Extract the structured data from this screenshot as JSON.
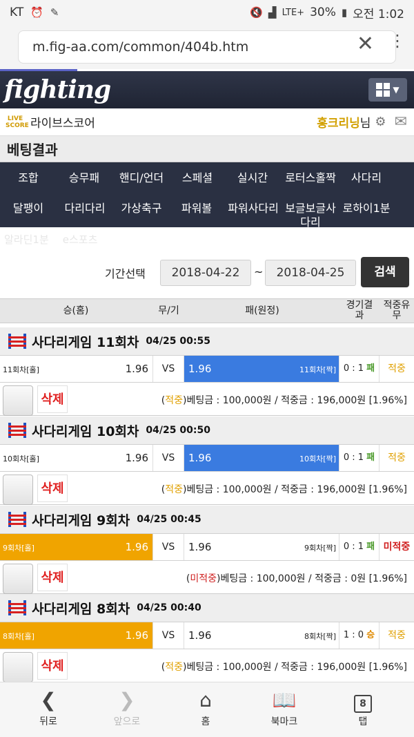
{
  "status_bar": {
    "carrier": "KT",
    "network": "LTE+",
    "battery": "30%",
    "time": "오전 1:02"
  },
  "browser": {
    "url": "m.fig-aa.com/common/404b.htm"
  },
  "site": {
    "logo": "fighting",
    "live_badge": "LIVE SCORE",
    "live_label": "라이브스코어",
    "user_name": "홍크리닝",
    "user_suffix": "님"
  },
  "page_title": "베팅결과",
  "categories": [
    "조합",
    "승무패",
    "핸디/언더",
    "스페셜",
    "실시간",
    "로터스홀짝",
    "사다리",
    "달팽이",
    "다리다리",
    "가상축구",
    "파워볼",
    "파워사다리",
    "보글보글사다리",
    "로하이1분"
  ],
  "categories_extra": [
    "알라딘1분",
    "e스포츠"
  ],
  "filter": {
    "label": "기간선택",
    "from": "2018-04-22",
    "tilde": "~",
    "to": "2018-04-25",
    "search": "검색"
  },
  "table_header": {
    "home": "승(홈)",
    "draw": "무/기",
    "away": "패(원정)",
    "result": "경기결과",
    "hit": "적중유무"
  },
  "games": [
    {
      "title": "사다리게임 11회차",
      "time": "04/25 00:55",
      "home_label": "11회차[홀]",
      "home_odd": "1.96",
      "vs": "VS",
      "away_odd": "1.96",
      "away_label": "11회차[짝]",
      "score": "0 : 1",
      "result": "패",
      "hit": "적중",
      "bet_tag": "적중",
      "bet_text": "베팅금 : 100,000원 / 적중금 : 196,000원 [1.96%]",
      "delete": "삭제"
    },
    {
      "title": "사다리게임 10회차",
      "time": "04/25 00:50",
      "home_label": "10회차[홀]",
      "home_odd": "1.96",
      "vs": "VS",
      "away_odd": "1.96",
      "away_label": "10회차[짝]",
      "score": "0 : 1",
      "result": "패",
      "hit": "적중",
      "bet_tag": "적중",
      "bet_text": "베팅금 : 100,000원 / 적중금 : 196,000원 [1.96%]",
      "delete": "삭제"
    },
    {
      "title": "사다리게임 9회차",
      "time": "04/25 00:45",
      "home_label": "9회차[홀]",
      "home_odd": "1.96",
      "vs": "VS",
      "away_odd": "1.96",
      "away_label": "9회차[짝]",
      "score": "0 : 1",
      "result": "패",
      "hit": "미적중",
      "bet_tag": "미적중",
      "bet_text": "베팅금 : 100,000원 / 적중금 : 0원 [1.96%]",
      "delete": "삭제"
    },
    {
      "title": "사다리게임 8회차",
      "time": "04/25 00:40",
      "home_label": "8회차[홀]",
      "home_odd": "1.96",
      "vs": "VS",
      "away_odd": "1.96",
      "away_label": "8회차[짝]",
      "score": "1 : 0",
      "result": "승",
      "hit": "적중",
      "bet_tag": "적중",
      "bet_text": "베팅금 : 100,000원 / 적중금 : 196,000원 [1.96%]",
      "delete": "삭제"
    }
  ],
  "bottom_nav": {
    "back": "뒤로",
    "forward": "앞으로",
    "home": "홈",
    "bookmark": "북마크",
    "tabs": "탭",
    "tab_count": "8"
  }
}
